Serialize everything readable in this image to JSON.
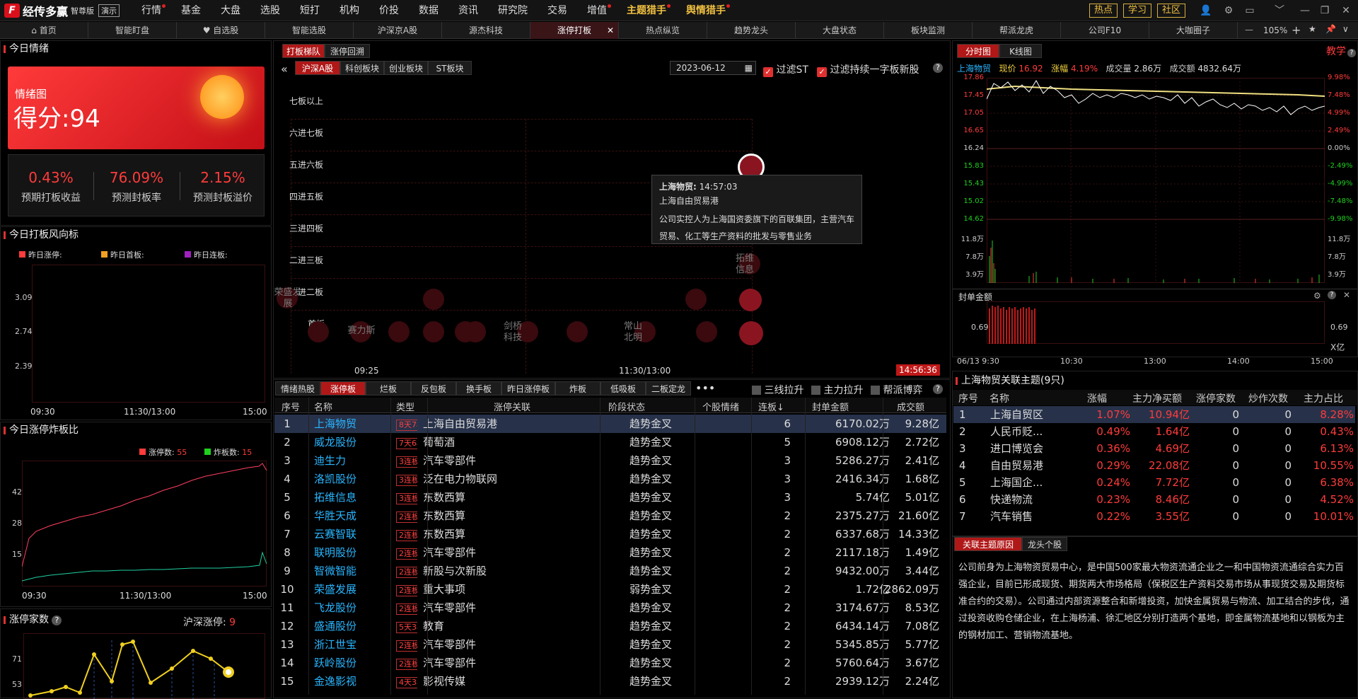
{
  "app": {
    "name": "经传多赢",
    "edition": "智尊版",
    "demo": "演示",
    "logo_char": "F"
  },
  "menu": [
    "行情",
    "基金",
    "大盘",
    "选股",
    "短打",
    "机构",
    "价投",
    "数据",
    "资讯",
    "研究院",
    "交易",
    "增值",
    "主题猎手",
    "舆情猎手"
  ],
  "top_buttons": [
    "热点",
    "学习",
    "社区"
  ],
  "tabs": [
    "首页",
    "智能盯盘",
    "自选股",
    "智能选股",
    "沪深京A股",
    "源杰科技",
    "涨停打板",
    "热点纵览",
    "趋势龙头",
    "大盘状态",
    "板块监测",
    "帮派龙虎",
    "公司F10",
    "大咖圈子"
  ],
  "zoom": "105%",
  "sentiment": {
    "title": "今日情绪",
    "card_label": "情绪图",
    "score": "得分:94",
    "stats": [
      {
        "value": "0.43%",
        "label": "预期打板收益"
      },
      {
        "value": "76.09%",
        "label": "预测封板率"
      },
      {
        "value": "2.15%",
        "label": "预测封板溢价"
      }
    ]
  },
  "risk": {
    "title": "今日打板风向标",
    "legend": [
      "昨日涨停:",
      "昨日首板:",
      "昨日连板:"
    ],
    "legend_colors": [
      "#ff3b3b",
      "#f0a020",
      "#a020c0"
    ],
    "y_ticks": [
      "3.09",
      "2.74",
      "2.39"
    ],
    "x_ticks": [
      "09:30",
      "11:30/13:00",
      "15:00"
    ]
  },
  "ratio": {
    "title": "今日涨停炸板比",
    "zt_label": "涨停数:",
    "zt_value": "55",
    "zb_label": "炸板数:",
    "zb_value": "15",
    "y_ticks": [
      "42",
      "28",
      "15"
    ],
    "x_ticks": [
      "09:30",
      "11:30/13:00",
      "15:00"
    ]
  },
  "count": {
    "title": "涨停家数",
    "market_label": "沪深涨停:",
    "market_value": "9",
    "y_ticks": [
      "71",
      "53"
    ]
  },
  "ladder": {
    "tabs": [
      "打板梯队",
      "涨停回溯"
    ],
    "market_tabs": [
      "沪深A股",
      "科创板块",
      "创业板块",
      "ST板块"
    ],
    "date": "2023-06-12",
    "filter1": "过滤ST",
    "filter2": "过滤持续一字板新股",
    "levels": [
      "七板以上",
      "六进七板",
      "五进六板",
      "四进五板",
      "三进四板",
      "二进三板",
      "一进二板",
      "首板"
    ],
    "x_ticks": [
      "09:25",
      "11:30/13:00",
      "14:56:36"
    ],
    "bubble_labels": [
      "荣盛发展",
      "赛力斯",
      "剑桥科技",
      "常山北明",
      "拓维信息",
      "贸"
    ],
    "tooltip": {
      "name": "上海物贸:",
      "time": "14:57:03",
      "theme": "上海自由贸易港",
      "desc": "公司实控人为上海国资委旗下的百联集团，主营汽车贸易、化工等生产资料的批发与零售业务"
    }
  },
  "table": {
    "tabs": [
      "情绪热股",
      "涨停板",
      "烂板",
      "反包板",
      "换手板",
      "昨日涨停板",
      "炸板",
      "低吸板",
      "二板定龙"
    ],
    "checks": [
      "三线拉升",
      "主力拉升",
      "帮派博弈"
    ],
    "headers": [
      "序号",
      "名称",
      "类型",
      "涨停关联",
      "阶段状态",
      "个股情绪",
      "连板↓",
      "封单金额",
      "成交额"
    ],
    "rows": [
      [
        "1",
        "上海物贸",
        "8天7板",
        "上海自由贸易港",
        "趋势金叉",
        "",
        "6",
        "6170.02万",
        "9.28亿"
      ],
      [
        "2",
        "威龙股份",
        "7天6板",
        "葡萄酒",
        "趋势金叉",
        "",
        "5",
        "6908.12万",
        "2.72亿"
      ],
      [
        "3",
        "迪生力",
        "3连板",
        "汽车零部件",
        "趋势金叉",
        "",
        "3",
        "5286.27万",
        "2.41亿"
      ],
      [
        "4",
        "洛凯股份",
        "3连板",
        "泛在电力物联网",
        "趋势金叉",
        "",
        "3",
        "2416.34万",
        "1.68亿"
      ],
      [
        "5",
        "拓维信息",
        "3连板",
        "东数西算",
        "趋势金叉",
        "",
        "3",
        "5.74亿",
        "5.01亿"
      ],
      [
        "6",
        "华胜天成",
        "2连板",
        "东数西算",
        "趋势金叉",
        "",
        "2",
        "2375.27万",
        "21.60亿"
      ],
      [
        "7",
        "云赛智联",
        "2连板",
        "东数西算",
        "趋势金叉",
        "",
        "2",
        "6337.68万",
        "14.33亿"
      ],
      [
        "8",
        "联明股份",
        "2连板",
        "汽车零部件",
        "趋势金叉",
        "",
        "2",
        "2117.18万",
        "1.49亿"
      ],
      [
        "9",
        "智微智能",
        "2连板",
        "新股与次新股",
        "趋势金叉",
        "",
        "2",
        "9432.00万",
        "3.44亿"
      ],
      [
        "10",
        "荣盛发展",
        "2连板",
        "重大事项",
        "弱势金叉",
        "",
        "2",
        "1.72亿",
        "2862.09万"
      ],
      [
        "11",
        "飞龙股份",
        "2连板",
        "汽车零部件",
        "趋势金叉",
        "",
        "2",
        "3174.67万",
        "8.53亿"
      ],
      [
        "12",
        "盛通股份",
        "5天3板",
        "教育",
        "趋势金叉",
        "",
        "2",
        "6434.14万",
        "7.08亿"
      ],
      [
        "13",
        "浙江世宝",
        "2连板",
        "汽车零部件",
        "趋势金叉",
        "",
        "2",
        "5345.85万",
        "5.77亿"
      ],
      [
        "14",
        "跃岭股份",
        "2连板",
        "汽车零部件",
        "趋势金叉",
        "",
        "2",
        "5760.64万",
        "3.67亿"
      ],
      [
        "15",
        "金逸影视",
        "4天3板",
        "影视传媒",
        "趋势金叉",
        "",
        "2",
        "2939.12万",
        "2.24亿"
      ]
    ]
  },
  "chart": {
    "tabs": [
      "分时图",
      "K线图"
    ],
    "teach": "教学",
    "stock": "上海物贸",
    "price_label": "现价",
    "price": "16.92",
    "chg_label": "涨幅",
    "chg": "4.19%",
    "vol_label": "成交量",
    "vol": "2.86万",
    "amt_label": "成交额",
    "amt": "4832.64万",
    "left_ticks": [
      "17.86",
      "17.45",
      "17.05",
      "16.65",
      "16.24",
      "15.83",
      "15.43",
      "15.02",
      "14.62",
      "11.8万",
      "7.8万",
      "3.9万"
    ],
    "right_ticks": [
      "9.98%",
      "7.48%",
      "4.99%",
      "2.49%",
      "0.00%",
      "-2.49%",
      "-4.99%",
      "-7.48%",
      "-9.98%",
      "11.8万",
      "7.8万",
      "3.9万"
    ],
    "seal_title": "封单金额",
    "seal_tick": "0.69",
    "seal_unit": "X亿",
    "x_ticks": [
      "06/13 9:30",
      "10:30",
      "13:00",
      "14:00",
      "15:00"
    ]
  },
  "themes": {
    "title": "上海物贸关联主题(9只)",
    "headers": [
      "序号",
      "名称",
      "涨幅",
      "主力净买额",
      "涨停家数",
      "炒作次数",
      "主力占比"
    ],
    "rows": [
      [
        "1",
        "上海自贸区",
        "1.07%",
        "10.94亿",
        "0",
        "0",
        "8.28%"
      ],
      [
        "2",
        "人民币贬...",
        "0.49%",
        "1.64亿",
        "0",
        "0",
        "0.43%"
      ],
      [
        "3",
        "进口博览会",
        "0.36%",
        "4.69亿",
        "0",
        "0",
        "6.13%"
      ],
      [
        "4",
        "自由贸易港",
        "0.29%",
        "22.08亿",
        "0",
        "0",
        "10.55%"
      ],
      [
        "5",
        "上海国企...",
        "0.24%",
        "7.72亿",
        "0",
        "0",
        "6.38%"
      ],
      [
        "6",
        "快递物流",
        "0.23%",
        "8.46亿",
        "0",
        "0",
        "4.52%"
      ],
      [
        "7",
        "汽车销售",
        "0.22%",
        "3.55亿",
        "0",
        "0",
        "10.01%"
      ]
    ],
    "bottom_tabs": [
      "关联主题原因",
      "龙头个股"
    ],
    "reason": "公司前身为上海物资贸易中心，是中国500家最大物资流通企业之一和中国物资流通综合实力百强企业，目前已形成现货、期货两大市场格局（保税区生产资料交易市场从事现货交易及期货标准合约的交易）。公司通过内部资源整合和新增投资，加快金属贸易与物流、加工结合的步伐，通过投资收购仓储企业，在上海杨浦、徐汇地区分别打造两个基地，即金属物流基地和以钢板为主的钢材加工、营销物流基地。"
  }
}
